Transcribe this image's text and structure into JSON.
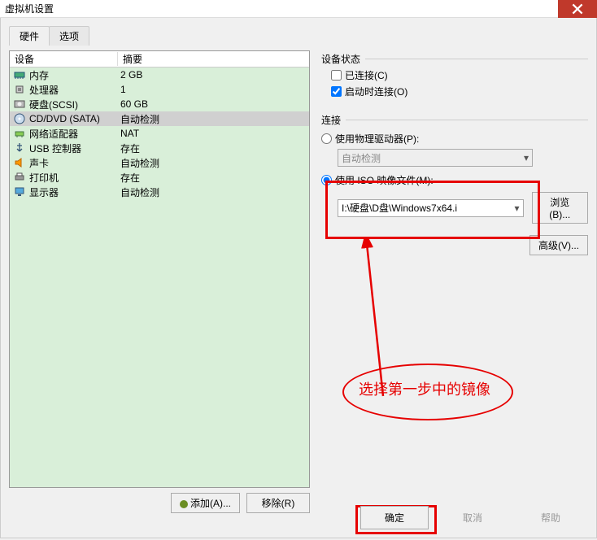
{
  "title": "虚拟机设置",
  "tabs": {
    "hardware": "硬件",
    "options": "选项"
  },
  "headers": {
    "device": "设备",
    "summary": "摘要"
  },
  "devices": [
    {
      "icon": "memory",
      "name": "内存",
      "summary": "2 GB",
      "selected": false
    },
    {
      "icon": "cpu",
      "name": "处理器",
      "summary": "1",
      "selected": false
    },
    {
      "icon": "hdd",
      "name": "硬盘(SCSI)",
      "summary": "60 GB",
      "selected": false
    },
    {
      "icon": "cd",
      "name": "CD/DVD (SATA)",
      "summary": "自动检测",
      "selected": true
    },
    {
      "icon": "net",
      "name": "网络适配器",
      "summary": "NAT",
      "selected": false
    },
    {
      "icon": "usb",
      "name": "USB 控制器",
      "summary": "存在",
      "selected": false
    },
    {
      "icon": "sound",
      "name": "声卡",
      "summary": "自动检测",
      "selected": false
    },
    {
      "icon": "printer",
      "name": "打印机",
      "summary": "存在",
      "selected": false
    },
    {
      "icon": "display",
      "name": "显示器",
      "summary": "自动检测",
      "selected": false
    }
  ],
  "buttons": {
    "add": "添加(A)...",
    "remove": "移除(R)",
    "ok": "确定",
    "cancel": "取消",
    "help": "帮助",
    "browse": "浏览(B)...",
    "advanced": "高级(V)..."
  },
  "right": {
    "status_title": "设备状态",
    "connected": "已连接(C)",
    "connect_poweron": "启动时连接(O)",
    "connection_title": "连接",
    "use_physical": "使用物理驱动器(P):",
    "physical_value": "自动检测",
    "use_iso": "使用 ISO 映像文件(M):",
    "iso_path": "I:\\硬盘\\D盘\\Windows7x64.i"
  },
  "annotation": "选择第一步中的镜像"
}
